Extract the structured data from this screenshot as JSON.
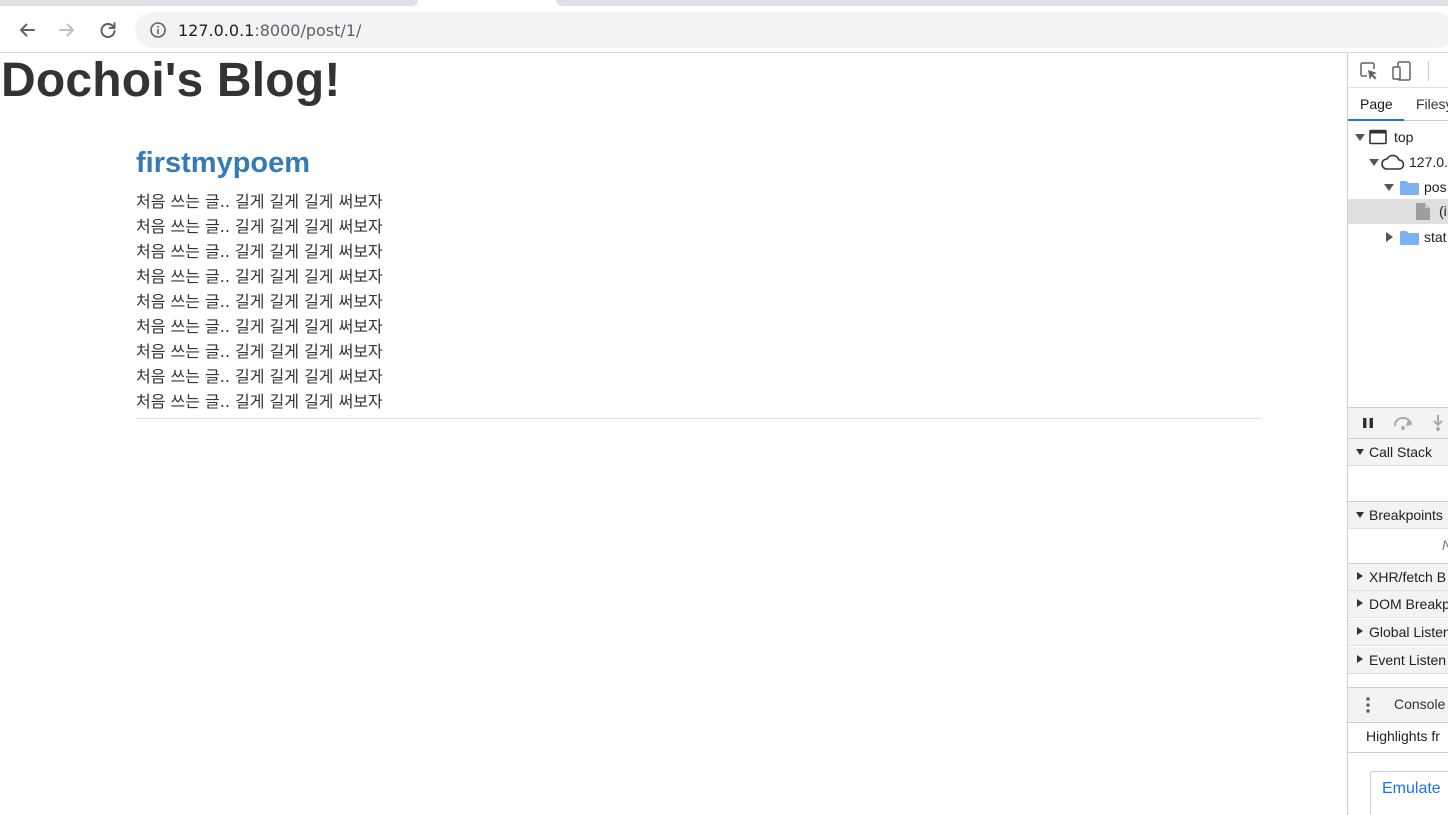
{
  "browser": {
    "url_host": "127.0.0.1",
    "url_path": ":8000/post/1/",
    "back_icon": "arrow-left-icon",
    "forward_icon": "arrow-right-icon",
    "reload_icon": "reload-icon",
    "info_icon": "info-circle-icon"
  },
  "page": {
    "site_title": "Dochoi's Blog!",
    "post": {
      "title": "firstmypoem",
      "lines": [
        "처음 쓰는 글.. 길게 길게 길게 써보자",
        "처음 쓰는 글.. 길게 길게 길게 써보자",
        "처음 쓰는 글.. 길게 길게 길게 써보자",
        "처음 쓰는 글.. 길게 길게 길게 써보자",
        "처음 쓰는 글.. 길게 길게 길게 써보자",
        "처음 쓰는 글.. 길게 길게 길게 써보자",
        "처음 쓰는 글.. 길게 길게 길게 써보자",
        "처음 쓰는 글.. 길게 길게 길게 써보자",
        "처음 쓰는 글.. 길게 길게 길게 써보자"
      ]
    },
    "colors": {
      "title_link": "#337ab7",
      "text": "#333333"
    }
  },
  "devtools": {
    "tabs": {
      "page": "Page",
      "filesystem": "Filesy"
    },
    "tree": {
      "top": "top",
      "origin": "127.0.",
      "post_folder": "pos",
      "file": "(i",
      "static_folder": "stat"
    },
    "sections": {
      "call_stack": "Call Stack",
      "breakpoints": "Breakpoints",
      "breakpoints_empty": "N",
      "xhr": "XHR/fetch B",
      "dom": "DOM Breakp",
      "global": "Global Listen",
      "event": "Event Listen"
    },
    "console": {
      "label": "Console",
      "highlights": "Highlights fr",
      "emulate": "Emulate"
    }
  }
}
